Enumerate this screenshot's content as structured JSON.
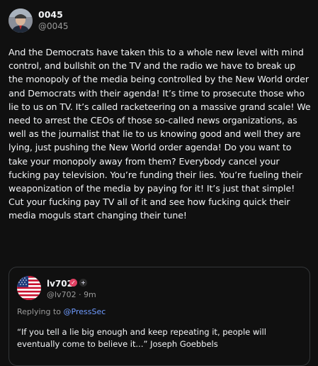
{
  "author": {
    "name": "0045",
    "handle": "@0045"
  },
  "post": {
    "text": "And the Democrats have taken this to a whole new level with mind control, and bullshit on the TV and the radio we have to break up the monopoly of the media being controlled by the New World order and Democrats with their agenda! It’s time to prosecute those who lie to us on TV. It’s called racketeering on a massive grand scale! We need to arrest the CEOs of those so-called news organizations, as well as the journalist that lie to us knowing good and well they are lying, just pushing the New World order agenda! Do you want to take your monopoly away from them? Everybody cancel your fucking pay television. You’re funding their lies. You’re fueling their weaponization of the media by paying for it! It’s just that simple! Cut your fucking pay TV all of it and see how fucking quick their media moguls start changing their tune!"
  },
  "quoted": {
    "name": "lv702",
    "handle": "@lv702",
    "separator": "·",
    "time": "9m",
    "reply_prefix": "Replying to",
    "reply_mention": "@PressSec",
    "text": "“If you tell a lie big enough and keep repeating it, people will eventually come to believe it...” Joseph Goebbels",
    "badge_verified": "✓",
    "badge_plus": "+",
    "avatar_icon": "us-flag-icon"
  },
  "colors": {
    "background": "#101010",
    "text": "#f3f5f7",
    "muted": "#9a9a9a",
    "mention": "#6f9bff",
    "verified": "#e04062"
  }
}
